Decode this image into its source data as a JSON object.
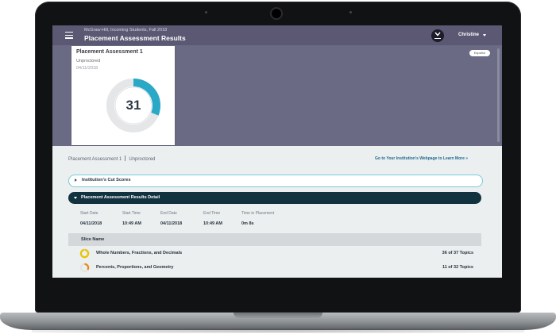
{
  "header": {
    "subtitle": "McGraw-Hill, Incoming Students, Fall 2018",
    "title": "Placement Assessment Results",
    "user_name": "Christine",
    "menu_icon": "hamburger-menu-icon",
    "download_icon": "download-icon"
  },
  "hero": {
    "language_button": "Español",
    "card": {
      "title": "Placement Assessment 1",
      "status": "Unproctored",
      "date": "04/11/2018",
      "score": "31",
      "score_fraction": 0.31,
      "ring_color": "#2aa8c6"
    }
  },
  "breadcrumb": {
    "assessment": "Placement Assessment 1",
    "status": "Unproctored"
  },
  "learn_more_link": "Go to Your Institution's Webpage to Learn More »",
  "accordions": {
    "cut_scores": "Institution's Cut Scores",
    "results_detail": "Placement Assessment Results Detail"
  },
  "details": {
    "headers": [
      "Start Date",
      "Start Time",
      "End Date",
      "End Time",
      "Time in Placement"
    ],
    "values": [
      "04/11/2018",
      "10:49 AM",
      "04/11/2018",
      "10:49 AM",
      "0m 8s"
    ]
  },
  "slices": {
    "header": "Slice Name",
    "rows": [
      {
        "name": "Whole Numbers, Fractions, and Decimals",
        "topics": "36 of 37 Topics",
        "progress": 0.97,
        "color": "#e8c400"
      },
      {
        "name": "Percents, Proportions, and Geometry",
        "topics": "11 of 32 Topics",
        "progress": 0.34,
        "color": "#e88a1a"
      }
    ]
  },
  "colors": {
    "header_bg": "#5a5872",
    "hero_bg": "#6b6a84",
    "accordion_dark": "#12323f",
    "link": "#1f6a8e"
  }
}
